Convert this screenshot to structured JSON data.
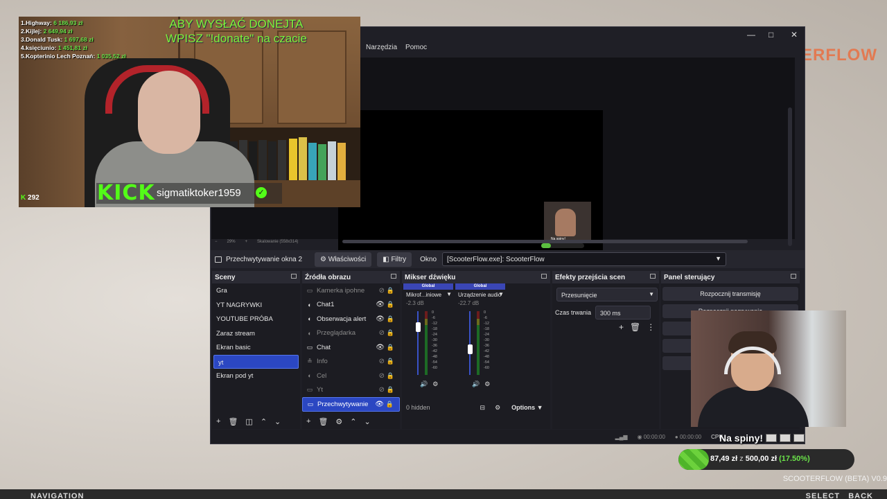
{
  "obs": {
    "menu": [
      "Narzędzia",
      "Pomoc"
    ],
    "window_controls": [
      "—",
      "□",
      "✕"
    ],
    "zoom_label": "29%",
    "scale_label": "Skalowanie (558x314)",
    "source_bar": {
      "title": "Przechwytywanie okna 2",
      "properties": "Właściwości",
      "filters": "Filtry",
      "okno_label": "Okno",
      "okno_value": "[ScooterFlow.exe]: ScooterFlow"
    },
    "scenes": {
      "title": "Sceny",
      "items": [
        "Gra",
        "YT NAGRYWKI",
        "YOUTUBE PRÓBA",
        "Zaraz stream",
        "Ekran basic",
        "yt",
        "Ekran pod yt"
      ],
      "active_index": 5
    },
    "sources": {
      "title": "Źródła obrazu",
      "items": [
        {
          "label": "Kamerka ipohne",
          "visible": false
        },
        {
          "label": "Chat1",
          "visible": true
        },
        {
          "label": "Obserwacja alert",
          "visible": true
        },
        {
          "label": "Przeglądarka",
          "visible": false
        },
        {
          "label": "Chat",
          "visible": true
        },
        {
          "label": "Info",
          "visible": false
        },
        {
          "label": "Cel",
          "visible": false
        },
        {
          "label": "Yt",
          "visible": false
        },
        {
          "label": "Przechwytywanie",
          "visible": true
        }
      ],
      "active_index": 8
    },
    "mixer": {
      "title": "Mikser dźwięku",
      "channels": [
        {
          "tag": "Global",
          "name": "Mikrof...iniowe",
          "db": "-2.3 dB",
          "level": 0.75
        },
        {
          "tag": "Global",
          "name": "Urządzenie audio",
          "db": "-22.7 dB",
          "level": 0.4
        }
      ],
      "ticks": [
        "0",
        "-6",
        "-12",
        "-18",
        "-24",
        "-30",
        "-36",
        "-42",
        "-48",
        "-54",
        "-60"
      ],
      "hidden": "0 hidden",
      "options": "Options"
    },
    "transitions": {
      "title": "Efekty przejścia scen",
      "selected": "Przesunięcie",
      "duration_label": "Czas trwania",
      "duration_value": "300 ms"
    },
    "controls": {
      "title": "Panel sterujący",
      "buttons": [
        "Rozpocznij transmisję",
        "Rozpocznij nagrywanie",
        "U",
        "",
        ""
      ]
    },
    "status": {
      "time1": "00:00:00",
      "time2": "00:00:00",
      "cpu": "CPU"
    }
  },
  "overlay": {
    "donations": [
      {
        "name": "1.Highway:",
        "amount": "6 186,93 zł"
      },
      {
        "name": "2.Kijlej:",
        "amount": "2 649,94 zł"
      },
      {
        "name": "3.Donald Tusk:",
        "amount": "1 697,68 zł"
      },
      {
        "name": "4.księciunio:",
        "amount": "1 451,81 zł"
      },
      {
        "name": "5.Kopterinio Lech Poznań:",
        "amount": "1 035,52 zł"
      }
    ],
    "donate_msg_line1": "ABY WYSŁAĆ DONEJTA",
    "donate_msg_line2": "WPISZ \"!donate\" na czacie",
    "kick_logo": "KICK",
    "kick_user": "sigmatiktoker1959",
    "viewers_icon": "K",
    "viewers": "292",
    "na_spiny": "Na spiny!",
    "goal": {
      "current": "87,49 zł",
      "z": "z",
      "target": "500,00 zł",
      "pct": "(17.50%)",
      "fraction": 0.175
    },
    "mini_cam_text": "Na spiny!",
    "brand": "ERFLOW",
    "brand_bottom": "SCOOTERFLOW (BETA) V0.9",
    "nav_left": "NAVIGATION",
    "nav_right_1": "SELECT",
    "nav_right_2": "BACK"
  }
}
